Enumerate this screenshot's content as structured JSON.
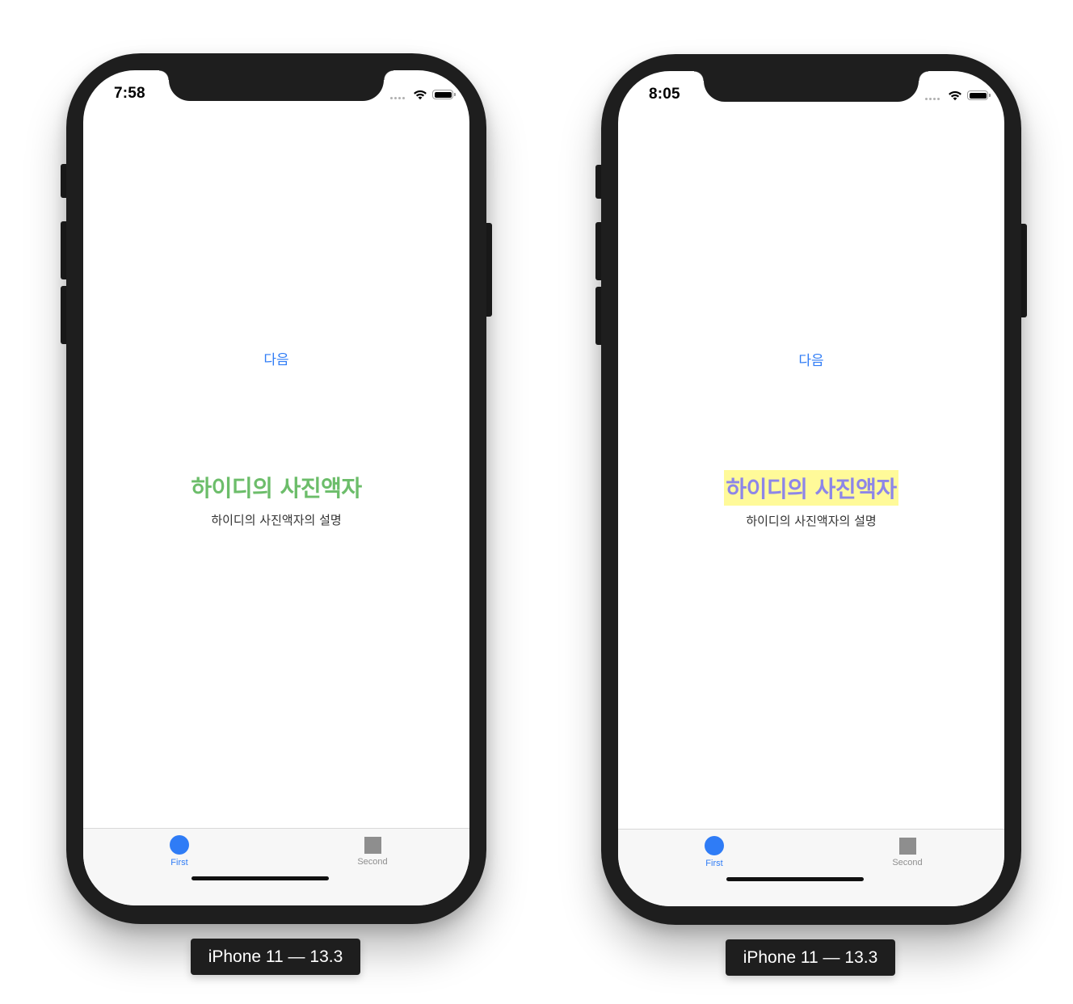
{
  "devices": [
    {
      "status_time": "7:58",
      "next_button": "다음",
      "title": "하이디의 사진액자",
      "subtitle": "하이디의 사진액자의 설명",
      "title_color": "#6cbd6a",
      "title_highlight": "",
      "tabs": [
        {
          "label": "First",
          "icon": "circle-icon",
          "color": "#2f7cf6",
          "selected": true
        },
        {
          "label": "Second",
          "icon": "square-icon",
          "color": "#8e8e8e",
          "selected": false
        }
      ],
      "caption": "iPhone 11 — 13.3"
    },
    {
      "status_time": "8:05",
      "next_button": "다음",
      "title": "하이디의 사진액자",
      "subtitle": "하이디의 사진액자의 설명",
      "title_color": "#8d86e8",
      "title_highlight": "#fffa99",
      "tabs": [
        {
          "label": "First",
          "icon": "circle-icon",
          "color": "#2f7cf6",
          "selected": true
        },
        {
          "label": "Second",
          "icon": "square-icon",
          "color": "#8e8e8e",
          "selected": false
        }
      ],
      "caption": "iPhone 11 — 13.3"
    }
  ],
  "colors": {
    "accent": "#2f7cf6",
    "frame": "#1e1e1e",
    "tabbar_bg": "#f7f7f7",
    "inactive_tab": "#8e8e8e"
  }
}
